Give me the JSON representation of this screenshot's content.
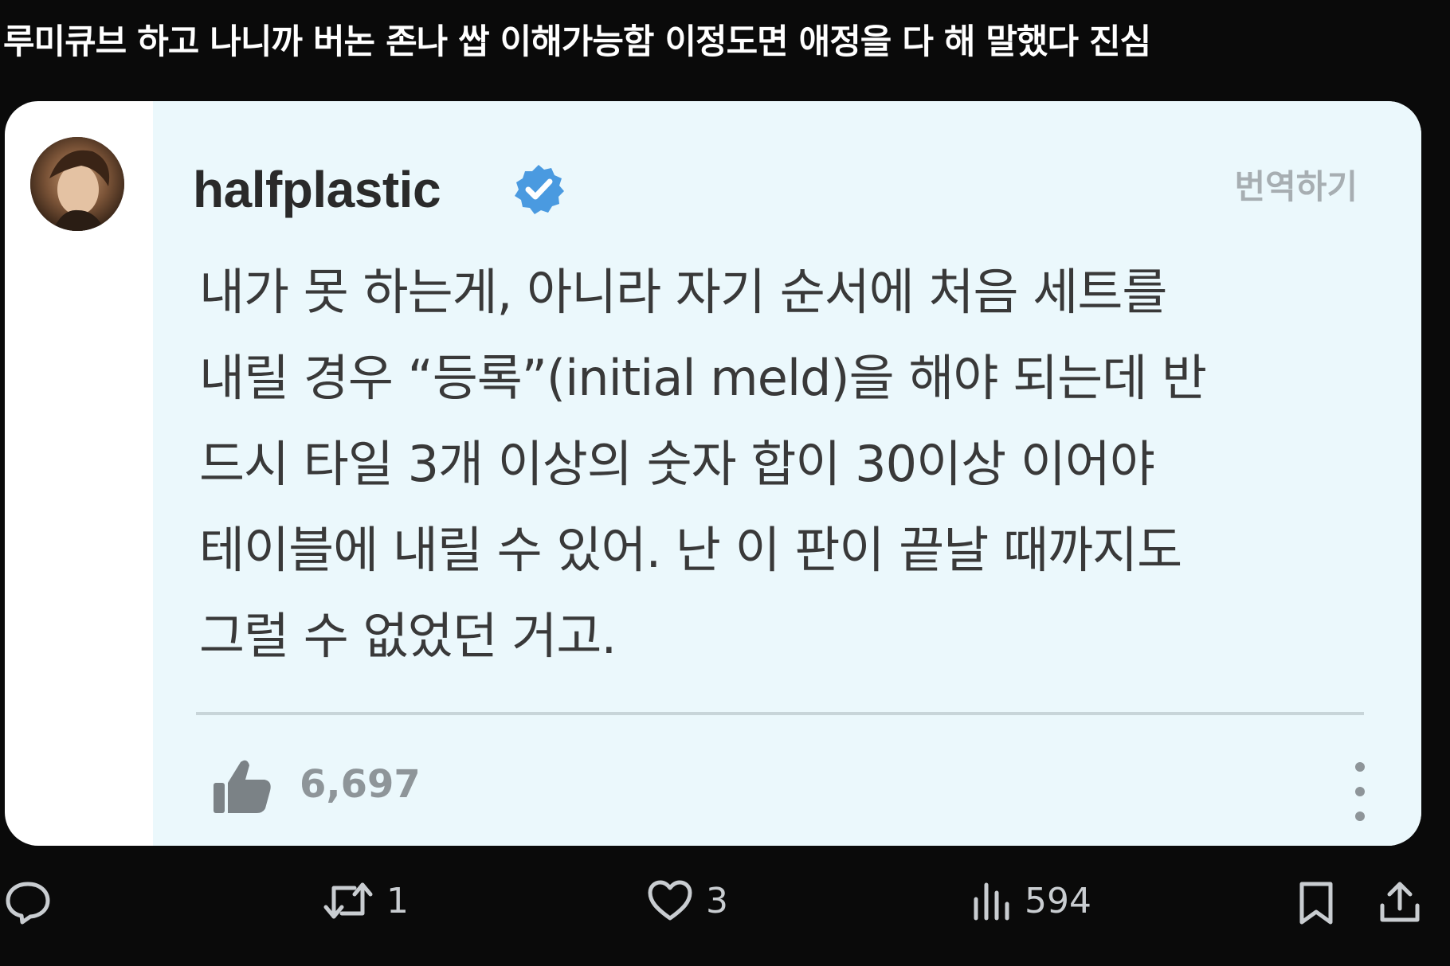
{
  "post": {
    "text_part1": "루미큐브",
    "text_part2": " 하고 나니까 ",
    "text_part3": "버논",
    "text_part4": " 존나 쌉 이해가능함 이정도면 애정을 다 해 말했다 진심"
  },
  "quoted_comment": {
    "author": "halfplastic",
    "verified": true,
    "translate_label": "번역하기",
    "lines": [
      "내가 못 하는게, 아니라 자기 순서에 처음 세트를",
      "내릴 경우 “등록”(initial meld)을 해야 되는데 반",
      "드시 타일 3개 이상의 숫자 합이 30이상 이어야",
      "테이블에 내릴 수 있어. 난 이 판이 끝날 때까지도",
      "그럴 수 없었던 거고."
    ],
    "likes": "6,697",
    "colors": {
      "card_bg": "#ffffff",
      "comment_bg": "#ebf8fc",
      "verified_blue": "#4a9ae0"
    }
  },
  "actions": {
    "reply_count": "",
    "repost_count": "1",
    "like_count": "3",
    "views_count": "594"
  },
  "icons": [
    "reply-icon",
    "repost-icon",
    "heart-icon",
    "views-icon",
    "bookmark-icon",
    "share-icon",
    "thumbs-up-icon",
    "verified-badge-icon",
    "more-vertical-icon"
  ]
}
